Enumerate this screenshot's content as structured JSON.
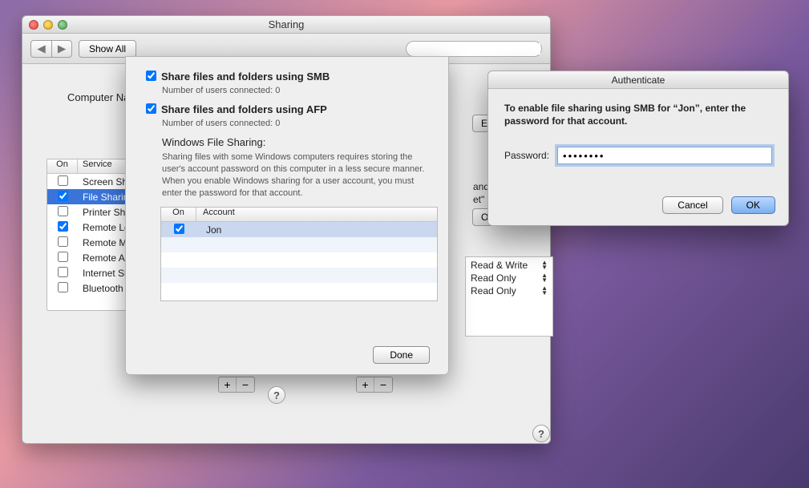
{
  "window": {
    "title": "Sharing"
  },
  "toolbar": {
    "back_icon": "◀",
    "fwd_icon": "▶",
    "show_all": "Show All",
    "search_placeholder": ""
  },
  "computer_name_label": "Computer Na",
  "services": {
    "col_on": "On",
    "col_service": "Service",
    "items": [
      {
        "on": false,
        "label": "Screen Sha"
      },
      {
        "on": true,
        "label": "File Sharing",
        "selected": true
      },
      {
        "on": false,
        "label": "Printer Sha"
      },
      {
        "on": true,
        "label": "Remote Lo"
      },
      {
        "on": false,
        "label": "Remote Ma"
      },
      {
        "on": false,
        "label": "Remote Ap"
      },
      {
        "on": false,
        "label": "Internet Sh"
      },
      {
        "on": false,
        "label": "Bluetooth S"
      }
    ]
  },
  "peek": {
    "and_adm": "and adm",
    "et_or_s": "et\" or \"s",
    "edit": "Ed",
    "options": "O"
  },
  "permissions": {
    "items": [
      {
        "label": "Read & Write"
      },
      {
        "label": "Read Only"
      },
      {
        "label": "Read Only"
      }
    ]
  },
  "addremove": {
    "plus": "+",
    "minus": "−"
  },
  "sheet": {
    "smb_label": "Share files and folders using SMB",
    "smb_sub": "Number of users connected: 0",
    "afp_label": "Share files and folders using AFP",
    "afp_sub": "Number of users connected: 0",
    "wfs_head": "Windows File Sharing:",
    "wfs_body": "Sharing files with some Windows computers requires storing the user's account password on this computer in a less secure manner.  When you enable Windows sharing for a user account, you must enter the password for that account.",
    "col_on": "On",
    "col_account": "Account",
    "accounts": [
      {
        "on": true,
        "name": "Jon"
      }
    ],
    "done": "Done",
    "help": "?"
  },
  "auth": {
    "title": "Authenticate",
    "message": "To enable file sharing using SMB for “Jon”, enter the password for that account.",
    "password_label": "Password:",
    "password_value": "••••••••",
    "cancel": "Cancel",
    "ok": "OK"
  },
  "help": "?"
}
